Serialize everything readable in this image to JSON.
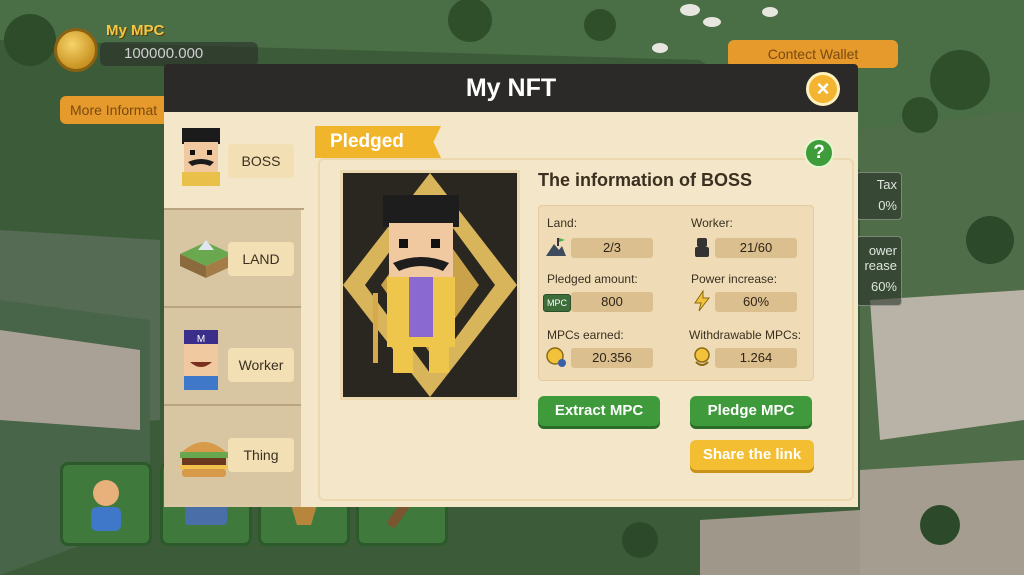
{
  "hud": {
    "my_mpc_label": "My MPC",
    "my_mpc_value": "100000.000",
    "connect_wallet": "Contect Wallet",
    "more_info": "More Informat"
  },
  "side_panels": {
    "tax_label": "Tax",
    "tax_value": "0%",
    "power_label": "ower",
    "power_sub": "rease",
    "power_value": "60%"
  },
  "modal": {
    "title": "My NFT",
    "close_label": "×",
    "tabs": [
      {
        "label": "BOSS",
        "icon": "boss-icon",
        "active": true
      },
      {
        "label": "LAND",
        "icon": "land-icon",
        "active": false
      },
      {
        "label": "Worker",
        "icon": "worker-icon",
        "active": false
      },
      {
        "label": "Thing",
        "icon": "burger-icon",
        "active": false
      }
    ],
    "status_tag": "Pledged",
    "help_label": "?",
    "info_title": "The information of BOSS",
    "stats": {
      "land_label": "Land:",
      "land_value": "2/3",
      "worker_label": "Worker:",
      "worker_value": "21/60",
      "pledged_label": "Pledged amount:",
      "pledged_value": "800",
      "pledged_icon_text": "MPC",
      "power_label": "Power increase:",
      "power_value": "60%",
      "earned_label": "MPCs earned:",
      "earned_value": "20.356",
      "withdrawable_label": "Withdrawable MPCs:",
      "withdrawable_value": "1.264"
    },
    "buttons": {
      "extract": "Extract MPC",
      "pledge": "Pledge MPC",
      "share": "Share the link"
    }
  },
  "colors": {
    "header_bg": "#2b2a28",
    "panel_bg": "#f4e6c8",
    "accent_yellow": "#f3b531",
    "button_green": "#3f9a3c"
  }
}
